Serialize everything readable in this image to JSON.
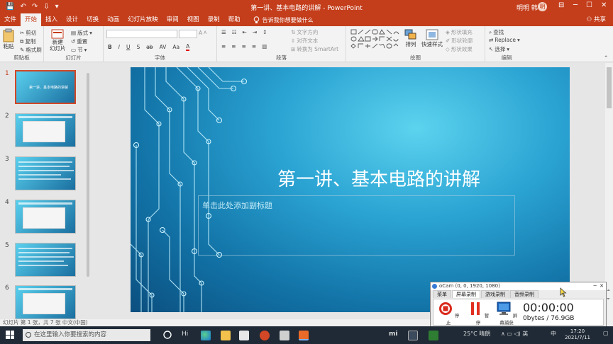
{
  "window": {
    "title": "第一讲、基本电路的讲解 - PowerPoint",
    "user": "明明 韩",
    "user_initial": "明",
    "controls": [
      "─",
      "☐",
      "✕"
    ],
    "ribbon_display": "⊟"
  },
  "quick_access": [
    "💾",
    "↶",
    "↷",
    "⇩",
    "▾"
  ],
  "tabs": [
    {
      "label": "文件",
      "active": false
    },
    {
      "label": "开始",
      "active": true
    },
    {
      "label": "插入",
      "active": false
    },
    {
      "label": "设计",
      "active": false
    },
    {
      "label": "切换",
      "active": false
    },
    {
      "label": "动画",
      "active": false
    },
    {
      "label": "幻灯片放映",
      "active": false
    },
    {
      "label": "审阅",
      "active": false
    },
    {
      "label": "视图",
      "active": false
    },
    {
      "label": "录制",
      "active": false
    },
    {
      "label": "帮助",
      "active": false
    }
  ],
  "tell_me": "告诉我你想要做什么",
  "share": "共享",
  "ribbon": {
    "clipboard": {
      "label": "剪贴板",
      "paste": "粘贴",
      "cut": "剪切",
      "copy": "复制",
      "format_painter": "格式刷"
    },
    "slides": {
      "label": "幻灯片",
      "new_slide": "新建\n幻灯片",
      "layout": "版式",
      "reset": "重置",
      "section": "节"
    },
    "font": {
      "label": "字体",
      "buttons": [
        "B",
        "I",
        "U",
        "S",
        "ab",
        "AV",
        "Aa",
        "A"
      ],
      "size_buttons": [
        "A",
        "A",
        "A"
      ]
    },
    "paragraph": {
      "label": "段落",
      "text_direction": "文字方向",
      "align_text": "对齐文本",
      "smartart": "转换为 SmartArt"
    },
    "drawing": {
      "label": "绘图",
      "arrange": "排列",
      "quick_styles": "快速样式",
      "shape_fill": "形状填充",
      "shape_outline": "形状轮廓",
      "shape_effects": "形状效果"
    },
    "editing": {
      "label": "编辑",
      "find": "查找",
      "replace": "Replace",
      "select": "选择"
    }
  },
  "thumbnails": [
    {
      "num": "1",
      "selected": true,
      "text": "第一讲、基本电路的讲解"
    },
    {
      "num": "2",
      "selected": false
    },
    {
      "num": "3",
      "selected": false
    },
    {
      "num": "4",
      "selected": false
    },
    {
      "num": "5",
      "selected": false
    },
    {
      "num": "6",
      "selected": false
    }
  ],
  "slide": {
    "title": "第一讲、基本电路的讲解",
    "subtitle_placeholder": "单击此处添加副标题"
  },
  "status": {
    "text": "幻灯片 第 1 张，共 7 张     中文(中国)"
  },
  "ocam": {
    "title": "oCam (0, 0, 1920, 1080)",
    "tabs": [
      "菜单",
      "屏幕录制",
      "游戏录制",
      "音频录制"
    ],
    "active_tab": 1,
    "buttons": [
      {
        "label": "停止"
      },
      {
        "label": "暂停"
      },
      {
        "label": "屏幕捕获"
      }
    ],
    "timer": "00:00:00",
    "size": "0bytes / 76.9GB",
    "colors": {
      "stop": "#d9291c",
      "pause": "#e03020",
      "capture": "#1c63b8"
    }
  },
  "taskbar": {
    "search_placeholder": "在这里输入你要搜索的内容",
    "tray": {
      "weather": "25°C 晴朗",
      "ime": "中",
      "icons": "∧  ▭  ◁)  英"
    },
    "time": "17:20",
    "date": "2021/7/11",
    "app_labels": {
      "hi": "Hi",
      "mi": "mi"
    }
  },
  "colors": {
    "ppt_red": "#c43e1c",
    "slide_teal": "#2aa3d3",
    "taskbar": "#1f2a36"
  }
}
